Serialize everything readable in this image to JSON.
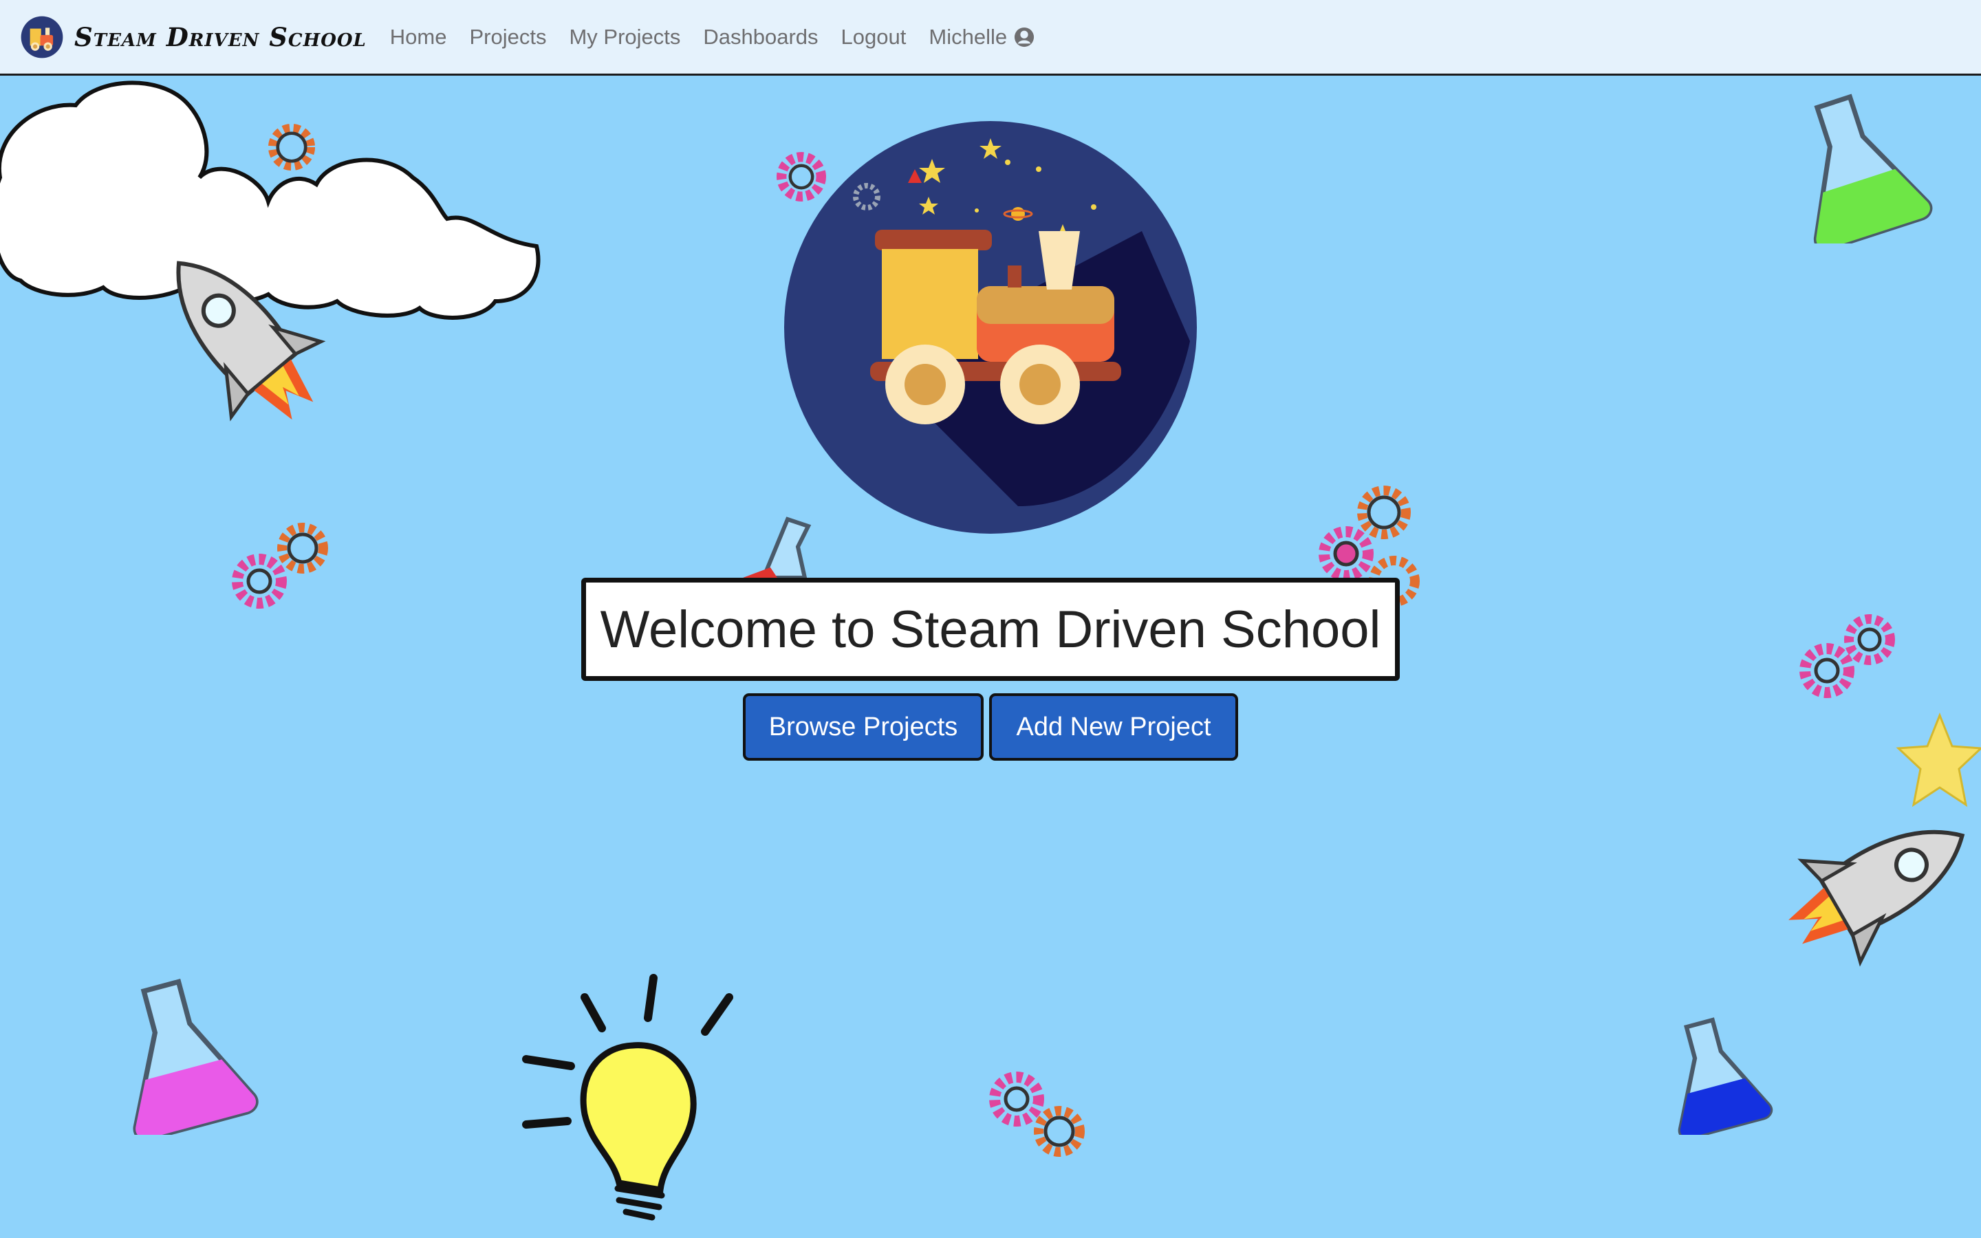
{
  "navbar": {
    "brand": {
      "name": "Steam Driven School",
      "logo_icon": "train-logo-icon"
    },
    "links": [
      {
        "label": "Home"
      },
      {
        "label": "Projects"
      },
      {
        "label": "My Projects"
      },
      {
        "label": "Dashboards"
      },
      {
        "label": "Logout"
      }
    ],
    "user": {
      "name": "Michelle",
      "icon": "user-circle-icon"
    }
  },
  "hero": {
    "title": "Welcome to Steam Driven School",
    "browse_label": "Browse Projects",
    "add_label": "Add New Project"
  },
  "colors": {
    "background": "#8fd3fb",
    "navbar_bg": "#e5f2fc",
    "button": "#2563c4",
    "logo_circle": "#2a3a78"
  },
  "decorations": [
    "cloud-icon",
    "rocket-icon",
    "gear-icon",
    "flask-icon",
    "lightbulb-icon",
    "star-icon"
  ]
}
